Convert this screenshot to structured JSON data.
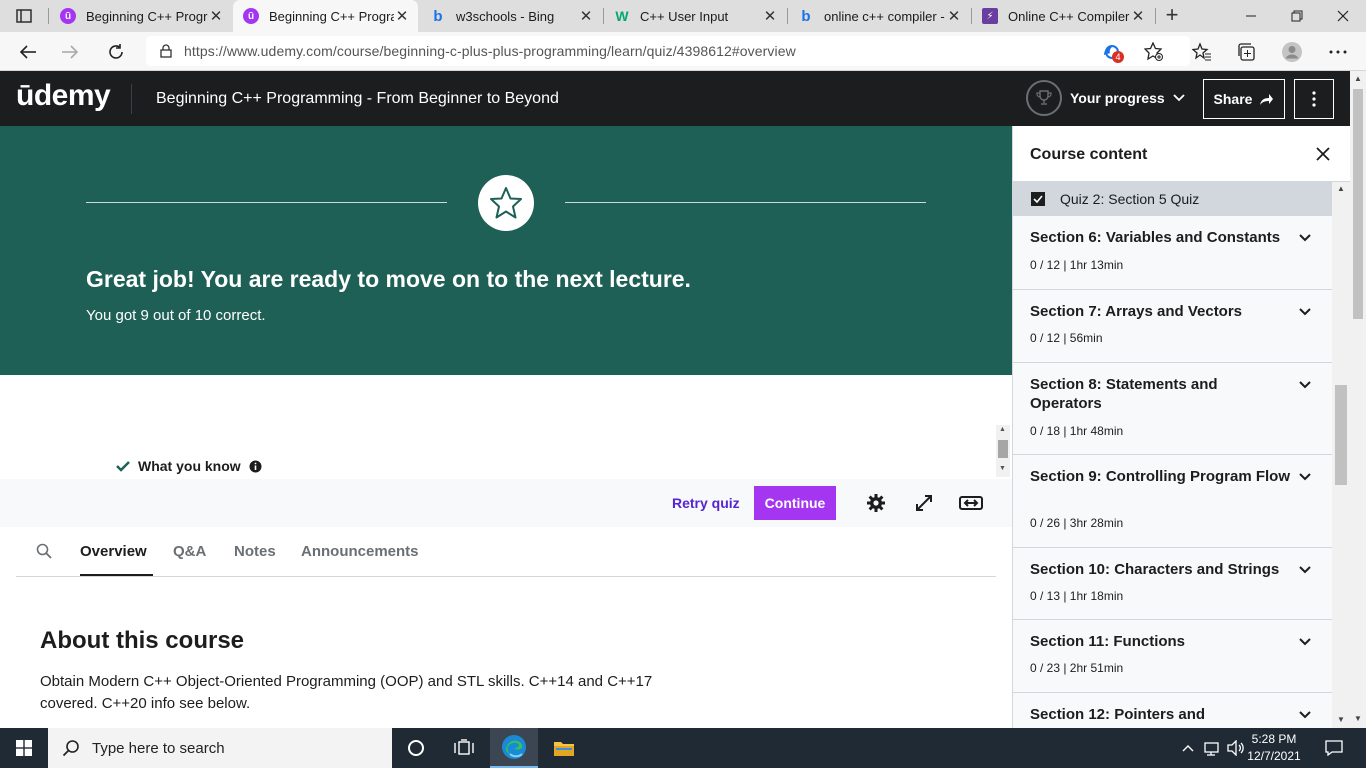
{
  "browser": {
    "tabs": [
      {
        "label": "Beginning C++ Progra",
        "icon": "udemy-icon",
        "active": false
      },
      {
        "label": "Beginning C++ Progra",
        "icon": "udemy-icon",
        "active": true
      },
      {
        "label": "w3schools - Bing",
        "icon": "bing-icon",
        "active": false
      },
      {
        "label": "C++ User Input",
        "icon": "w3schools-icon",
        "active": false
      },
      {
        "label": "online c++ compiler -",
        "icon": "bing-icon",
        "active": false
      },
      {
        "label": "Online C++ Compiler",
        "icon": "onlinegdb-icon",
        "active": false
      }
    ],
    "url": "https://www.udemy.com/course/beginning-c-plus-plus-programming/learn/quiz/4398612#overview",
    "extension_badge": "4"
  },
  "header": {
    "logo": "ūdemy",
    "course_title": "Beginning C++ Programming - From Beginner to Beyond",
    "progress_label": "Your progress",
    "share_label": "Share"
  },
  "quiz": {
    "heading": "Great job! You are ready to move on to the next lecture.",
    "score_text": "You got 9 out of 10 correct.",
    "what_you_know": "What you know",
    "retry_label": "Retry quiz",
    "continue_label": "Continue"
  },
  "tabs": {
    "items": [
      "Overview",
      "Q&A",
      "Notes",
      "Announcements"
    ],
    "active": "Overview"
  },
  "about": {
    "title": "About this course",
    "text": "Obtain Modern C++ Object-Oriented Programming (OOP) and STL skills. C++14 and C++17 covered. C++20 info see below."
  },
  "sidebar": {
    "title": "Course content",
    "current_item": "Quiz 2: Section 5 Quiz",
    "sections": [
      {
        "title": "Section 6: Variables and Constants",
        "meta": "0 / 12 | 1hr 13min"
      },
      {
        "title": "Section 7: Arrays and Vectors",
        "meta": "0 / 12 | 56min"
      },
      {
        "title": "Section 8: Statements and Operators",
        "meta": "0 / 18 | 1hr 48min"
      },
      {
        "title": "Section 9: Controlling Program Flow",
        "meta": "0 / 26 | 3hr 28min"
      },
      {
        "title": "Section 10: Characters and Strings",
        "meta": "0 / 13 | 1hr 18min"
      },
      {
        "title": "Section 11: Functions",
        "meta": "0 / 23 | 2hr 51min"
      },
      {
        "title": "Section 12: Pointers and",
        "meta": ""
      }
    ]
  },
  "taskbar": {
    "search_placeholder": "Type here to search",
    "time": "5:28 PM",
    "date": "12/7/2021"
  },
  "colors": {
    "udemy_dark": "#1c1d1f",
    "quiz_green": "#1e6055",
    "udemy_purple": "#a435f0",
    "retry_purple": "#5624d0"
  }
}
